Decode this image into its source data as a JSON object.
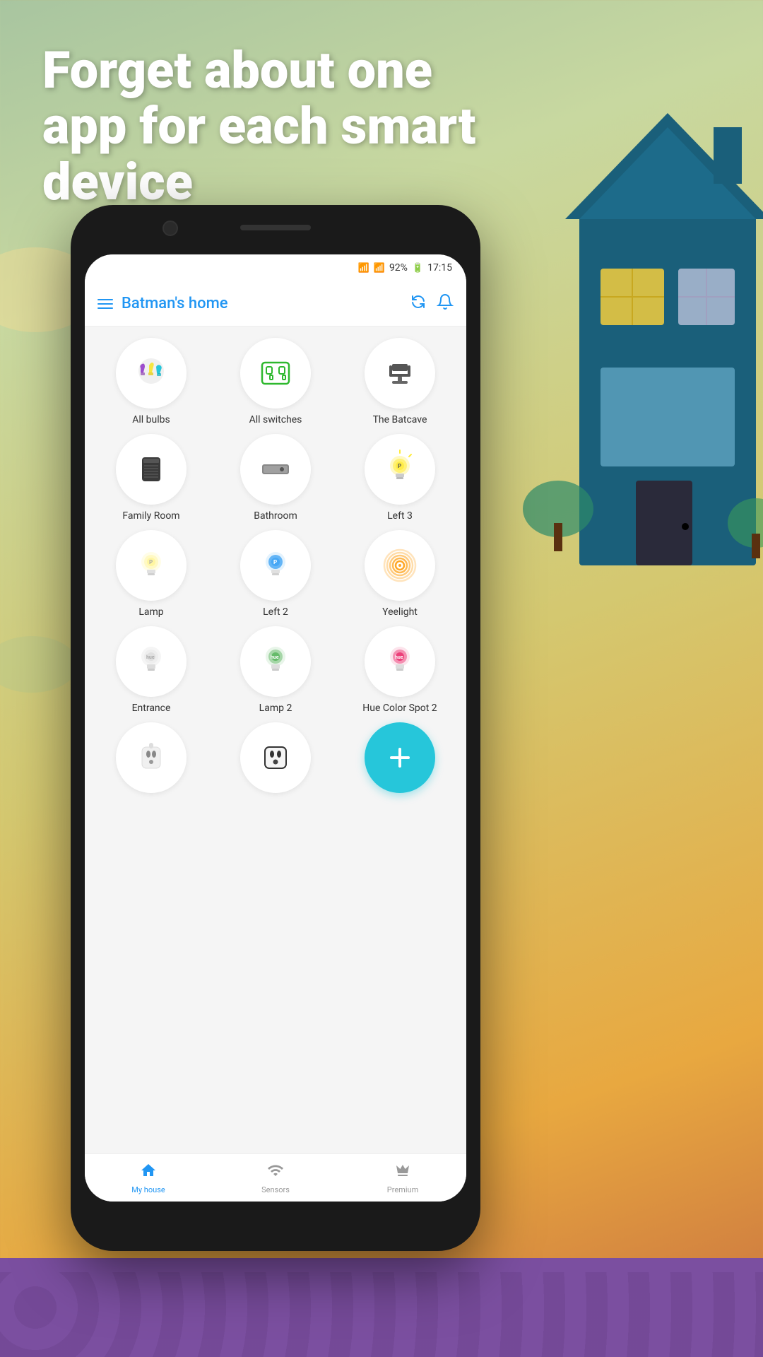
{
  "background": {
    "headline": "Forget about one app for each smart device"
  },
  "status_bar": {
    "wifi": "WiFi",
    "signal": "92%",
    "battery": "🔋",
    "time": "17:15"
  },
  "header": {
    "title": "Batman's home",
    "menu_label": "Menu",
    "refresh_label": "Refresh",
    "notifications_label": "Notifications"
  },
  "devices": [
    {
      "id": "all-bulbs",
      "label": "All bulbs",
      "icon": "bulbs",
      "emoji": "💡"
    },
    {
      "id": "all-switches",
      "label": "All switches",
      "icon": "switches",
      "emoji": "🔌"
    },
    {
      "id": "the-batcave",
      "label": "The Batcave",
      "icon": "batcave",
      "emoji": "🪑"
    },
    {
      "id": "family-room",
      "label": "Family Room",
      "icon": "speaker",
      "emoji": "🔊"
    },
    {
      "id": "bathroom",
      "label": "Bathroom",
      "icon": "device",
      "emoji": "📺"
    },
    {
      "id": "left-3",
      "label": "Left 3",
      "icon": "bulb-yellow",
      "emoji": "💛"
    },
    {
      "id": "lamp",
      "label": "Lamp",
      "icon": "lamp",
      "emoji": "🔆"
    },
    {
      "id": "left-2",
      "label": "Left 2",
      "icon": "lamp-blue",
      "emoji": "💙"
    },
    {
      "id": "yeelight",
      "label": "Yeelight",
      "icon": "yeelight",
      "emoji": "🌀"
    },
    {
      "id": "entrance",
      "label": "Entrance",
      "icon": "hue-white",
      "emoji": "🤍"
    },
    {
      "id": "lamp-2",
      "label": "Lamp 2",
      "icon": "hue-green",
      "emoji": "💚"
    },
    {
      "id": "hue-color-spot",
      "label": "Hue Color Spot 2",
      "icon": "hue-pink",
      "emoji": "🩷"
    },
    {
      "id": "device-1",
      "label": "",
      "icon": "plug",
      "emoji": "🔲"
    },
    {
      "id": "device-2",
      "label": "",
      "icon": "plug2",
      "emoji": "🔲"
    },
    {
      "id": "add",
      "label": "",
      "icon": "add",
      "emoji": "+"
    }
  ],
  "bottom_nav": [
    {
      "id": "my-house",
      "label": "My house",
      "icon": "home",
      "active": true
    },
    {
      "id": "sensors",
      "label": "Sensors",
      "icon": "sensors",
      "active": false
    },
    {
      "id": "premium",
      "label": "Premium",
      "icon": "crown",
      "active": false
    }
  ]
}
